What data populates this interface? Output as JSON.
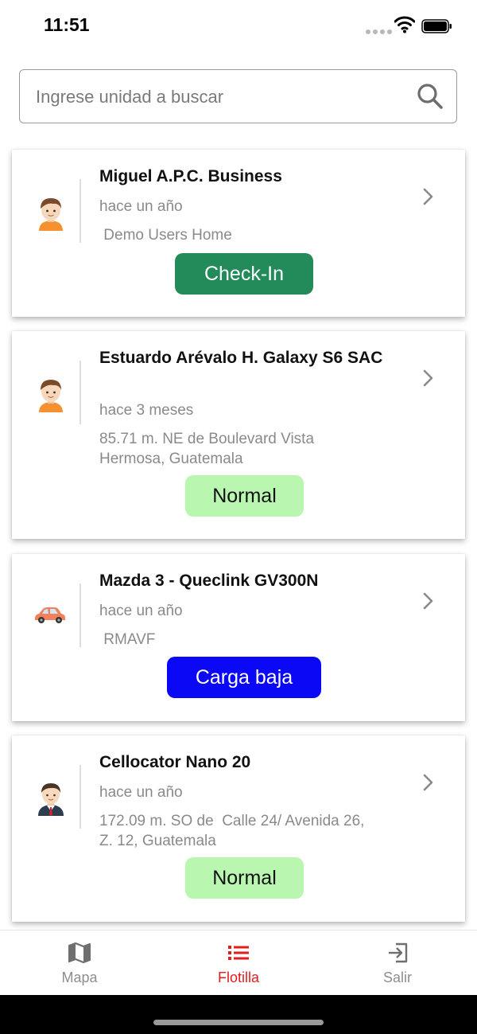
{
  "status_bar": {
    "time": "11:51"
  },
  "search": {
    "placeholder": "Ingrese unidad a buscar",
    "value": ""
  },
  "units": [
    {
      "name": "Miguel A.P.C. Business",
      "time": "hace un año",
      "location": " Demo Users Home",
      "status": "Check-In",
      "icon": "boy-avatar-icon",
      "status_bg": "#238a5a",
      "status_fg": "#ffffff"
    },
    {
      "name": "Estuardo Arévalo H. Galaxy S6 SAC",
      "time": "hace 3 meses",
      "location": "85.71 m. NE de Boulevard Vista Hermosa, Guatemala",
      "status": "Normal",
      "icon": "boy-avatar-icon",
      "status_bg": "#b9f7b0",
      "status_fg": "#111111"
    },
    {
      "name": "Mazda 3 - Queclink GV300N",
      "time": "hace un año",
      "location": " RMAVF",
      "status": "Carga baja",
      "icon": "car-icon",
      "status_bg": "#0a08f5",
      "status_fg": "#ffffff"
    },
    {
      "name": "Cellocator Nano 20",
      "time": "hace un año",
      "location": "172.09 m. SO de  Calle 24/ Avenida 26, Z. 12, Guatemala",
      "status": "Normal",
      "icon": "businessman-avatar-icon",
      "status_bg": "#b9f7b0",
      "status_fg": "#111111"
    }
  ],
  "tabbar": {
    "tabs": [
      {
        "label": "Mapa",
        "icon": "map-icon",
        "active": false
      },
      {
        "label": "Flotilla",
        "icon": "list-icon",
        "active": true
      },
      {
        "label": "Salir",
        "icon": "exit-icon",
        "active": false
      }
    ]
  },
  "colors": {
    "accent": "#e01e1e",
    "inactive_tab": "#8e8e8e"
  }
}
